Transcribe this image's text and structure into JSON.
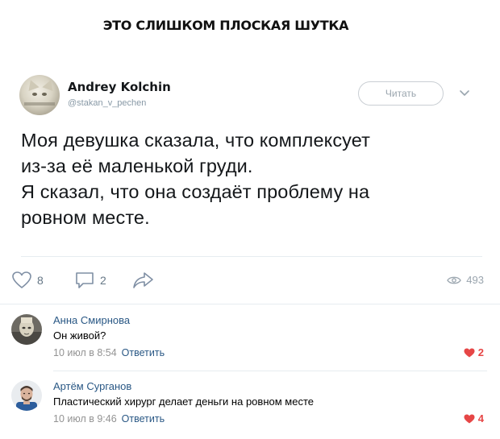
{
  "caption": "ЭТО СЛИШКОМ ПЛОСКАЯ ШУТКА",
  "tweet": {
    "author_name": "Andrey Kolchin",
    "author_handle": "@stakan_v_pechen",
    "follow_label": "Читать",
    "text_lines": [
      "Моя девушка сказала, что комплексует",
      "из-за её маленькой груди.",
      "Я сказал, что она создаёт проблему на",
      "ровном месте."
    ]
  },
  "actions": {
    "likes": "8",
    "comments": "2",
    "views": "493"
  },
  "comments": [
    {
      "author": "Анна Смирнова",
      "text": "Он живой?",
      "date": "10 июл в 8:54",
      "reply_label": "Ответить",
      "likes": "2"
    },
    {
      "author": "Артём Сурганов",
      "text": "Пластический хирург делает деньги на ровном месте",
      "date": "10 июл в 9:46",
      "reply_label": "Ответить",
      "likes": "4"
    }
  ],
  "colors": {
    "link": "#2a5885",
    "like_red": "#e64646",
    "muted": "#939393"
  }
}
